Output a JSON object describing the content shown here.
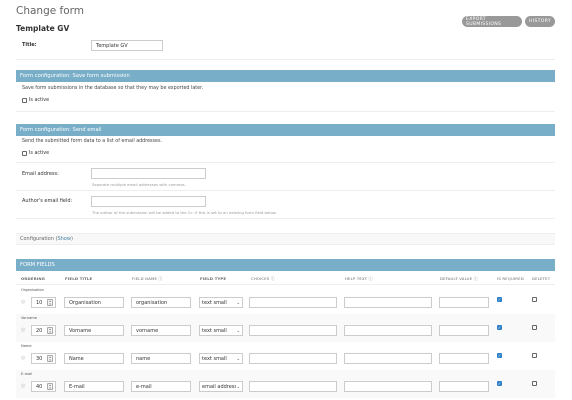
{
  "page_title": "Change form",
  "object_title": "Template GV",
  "toolbar": {
    "export_label": "EXPORT SUBMISSIONS",
    "history_label": "HISTORY"
  },
  "title_field": {
    "label": "Title:",
    "value": "Template GV"
  },
  "section_save": {
    "header": "Form configuration: Save form submission",
    "description": "Save form submissions in the database so that they may be exported later.",
    "checkbox_label": "Is active"
  },
  "section_email": {
    "header": "Form configuration: Send email",
    "description": "Send the submitted form data to a list of email addresses.",
    "checkbox_label": "Is active",
    "email_label": "Email address:",
    "email_help": "Separate multiple email addresses with commas.",
    "author_label": "Author's email field:",
    "author_help": "The author of the submission will be added to the Cc: if this is set to an existing form field below."
  },
  "configuration": {
    "prefix": "Configuration (",
    "link": "Show",
    "suffix": ")"
  },
  "form_fields": {
    "header": "FORM FIELDS",
    "columns": [
      "ORDERING",
      "FIELD TITLE",
      "FIELD NAME",
      "FIELD TYPE",
      "CHOICES",
      "HELP TEXT",
      "DEFAULT VALUE",
      "IS REQUIRED",
      "DELETE?"
    ],
    "rows": [
      {
        "label": "Organisation",
        "order": "10",
        "title": "Organisation",
        "name": "organisation",
        "type": "text small",
        "required": true,
        "delete": false
      },
      {
        "label": "Vorname",
        "order": "20",
        "title": "Vorname",
        "name": "vorname",
        "type": "text small",
        "required": true,
        "delete": false
      },
      {
        "label": "Name",
        "order": "30",
        "title": "Name",
        "name": "name",
        "type": "text small",
        "required": true,
        "delete": false
      },
      {
        "label": "E-mail",
        "order": "40",
        "title": "E-mail",
        "name": "e-mail",
        "type": "email address",
        "required": true,
        "delete": false
      }
    ]
  },
  "colors": {
    "section_bar": "#79aec8",
    "button_gray": "#999999",
    "checkbox_checked": "#2f80c9"
  }
}
